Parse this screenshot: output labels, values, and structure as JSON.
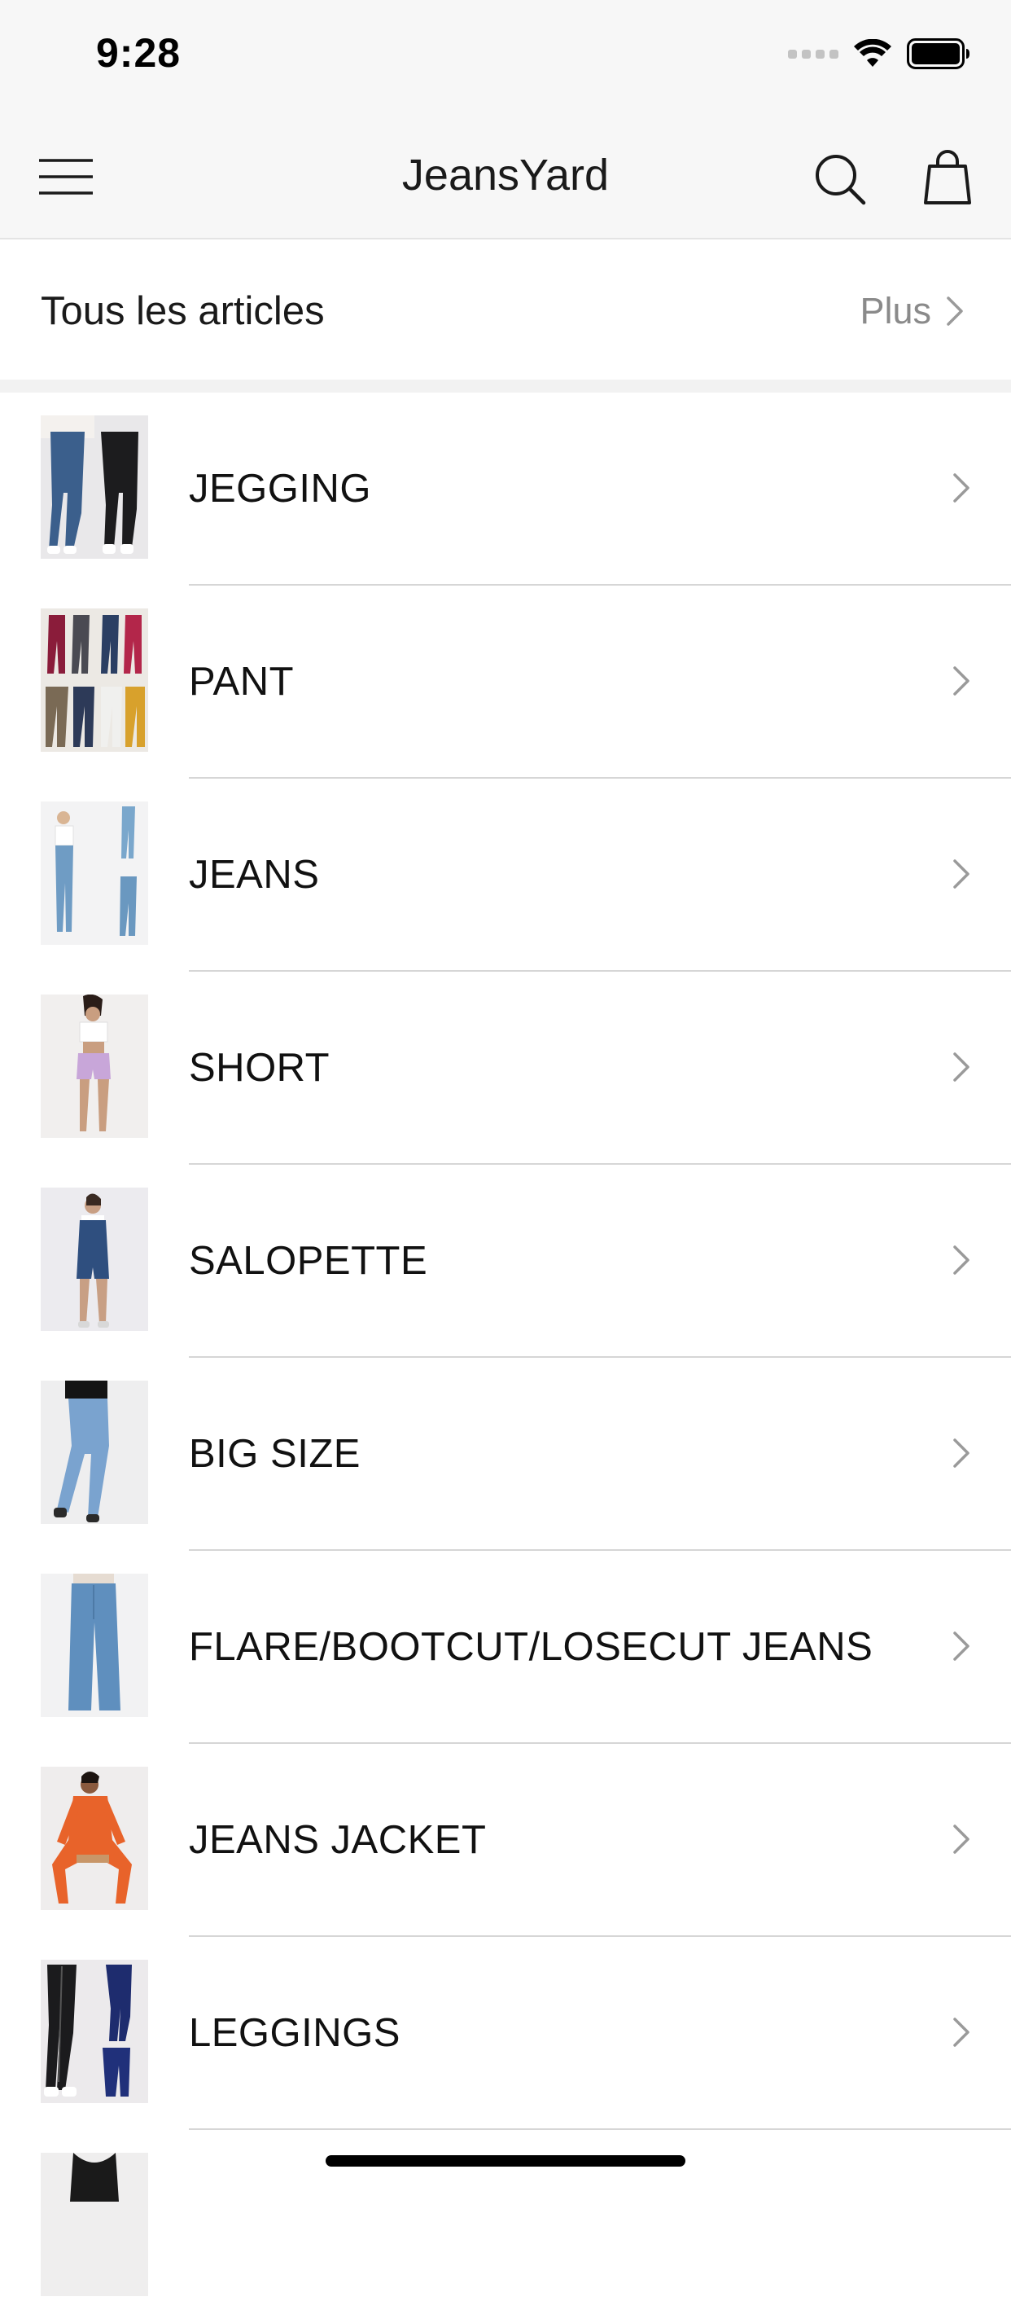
{
  "status_bar": {
    "time": "9:28"
  },
  "nav": {
    "title": "JeansYard",
    "menu_icon": "hamburger-menu-icon",
    "search_icon": "search-icon",
    "bag_icon": "shopping-bag-icon"
  },
  "all_articles": {
    "label": "Tous les articles",
    "more_label": "Plus"
  },
  "categories": [
    {
      "label": "JEGGING"
    },
    {
      "label": "PANT"
    },
    {
      "label": "JEANS"
    },
    {
      "label": "SHORT"
    },
    {
      "label": "SALOPETTE"
    },
    {
      "label": "BIG SIZE"
    },
    {
      "label": "FLARE/BOOTCUT/LOSECUT JEANS"
    },
    {
      "label": "JEANS JACKET"
    },
    {
      "label": "LEGGINGS"
    }
  ],
  "colors": {
    "background": "#ffffff",
    "bar_background": "#f7f7f7",
    "divider": "#d6d6d6",
    "muted_text": "#8a8a8a"
  }
}
